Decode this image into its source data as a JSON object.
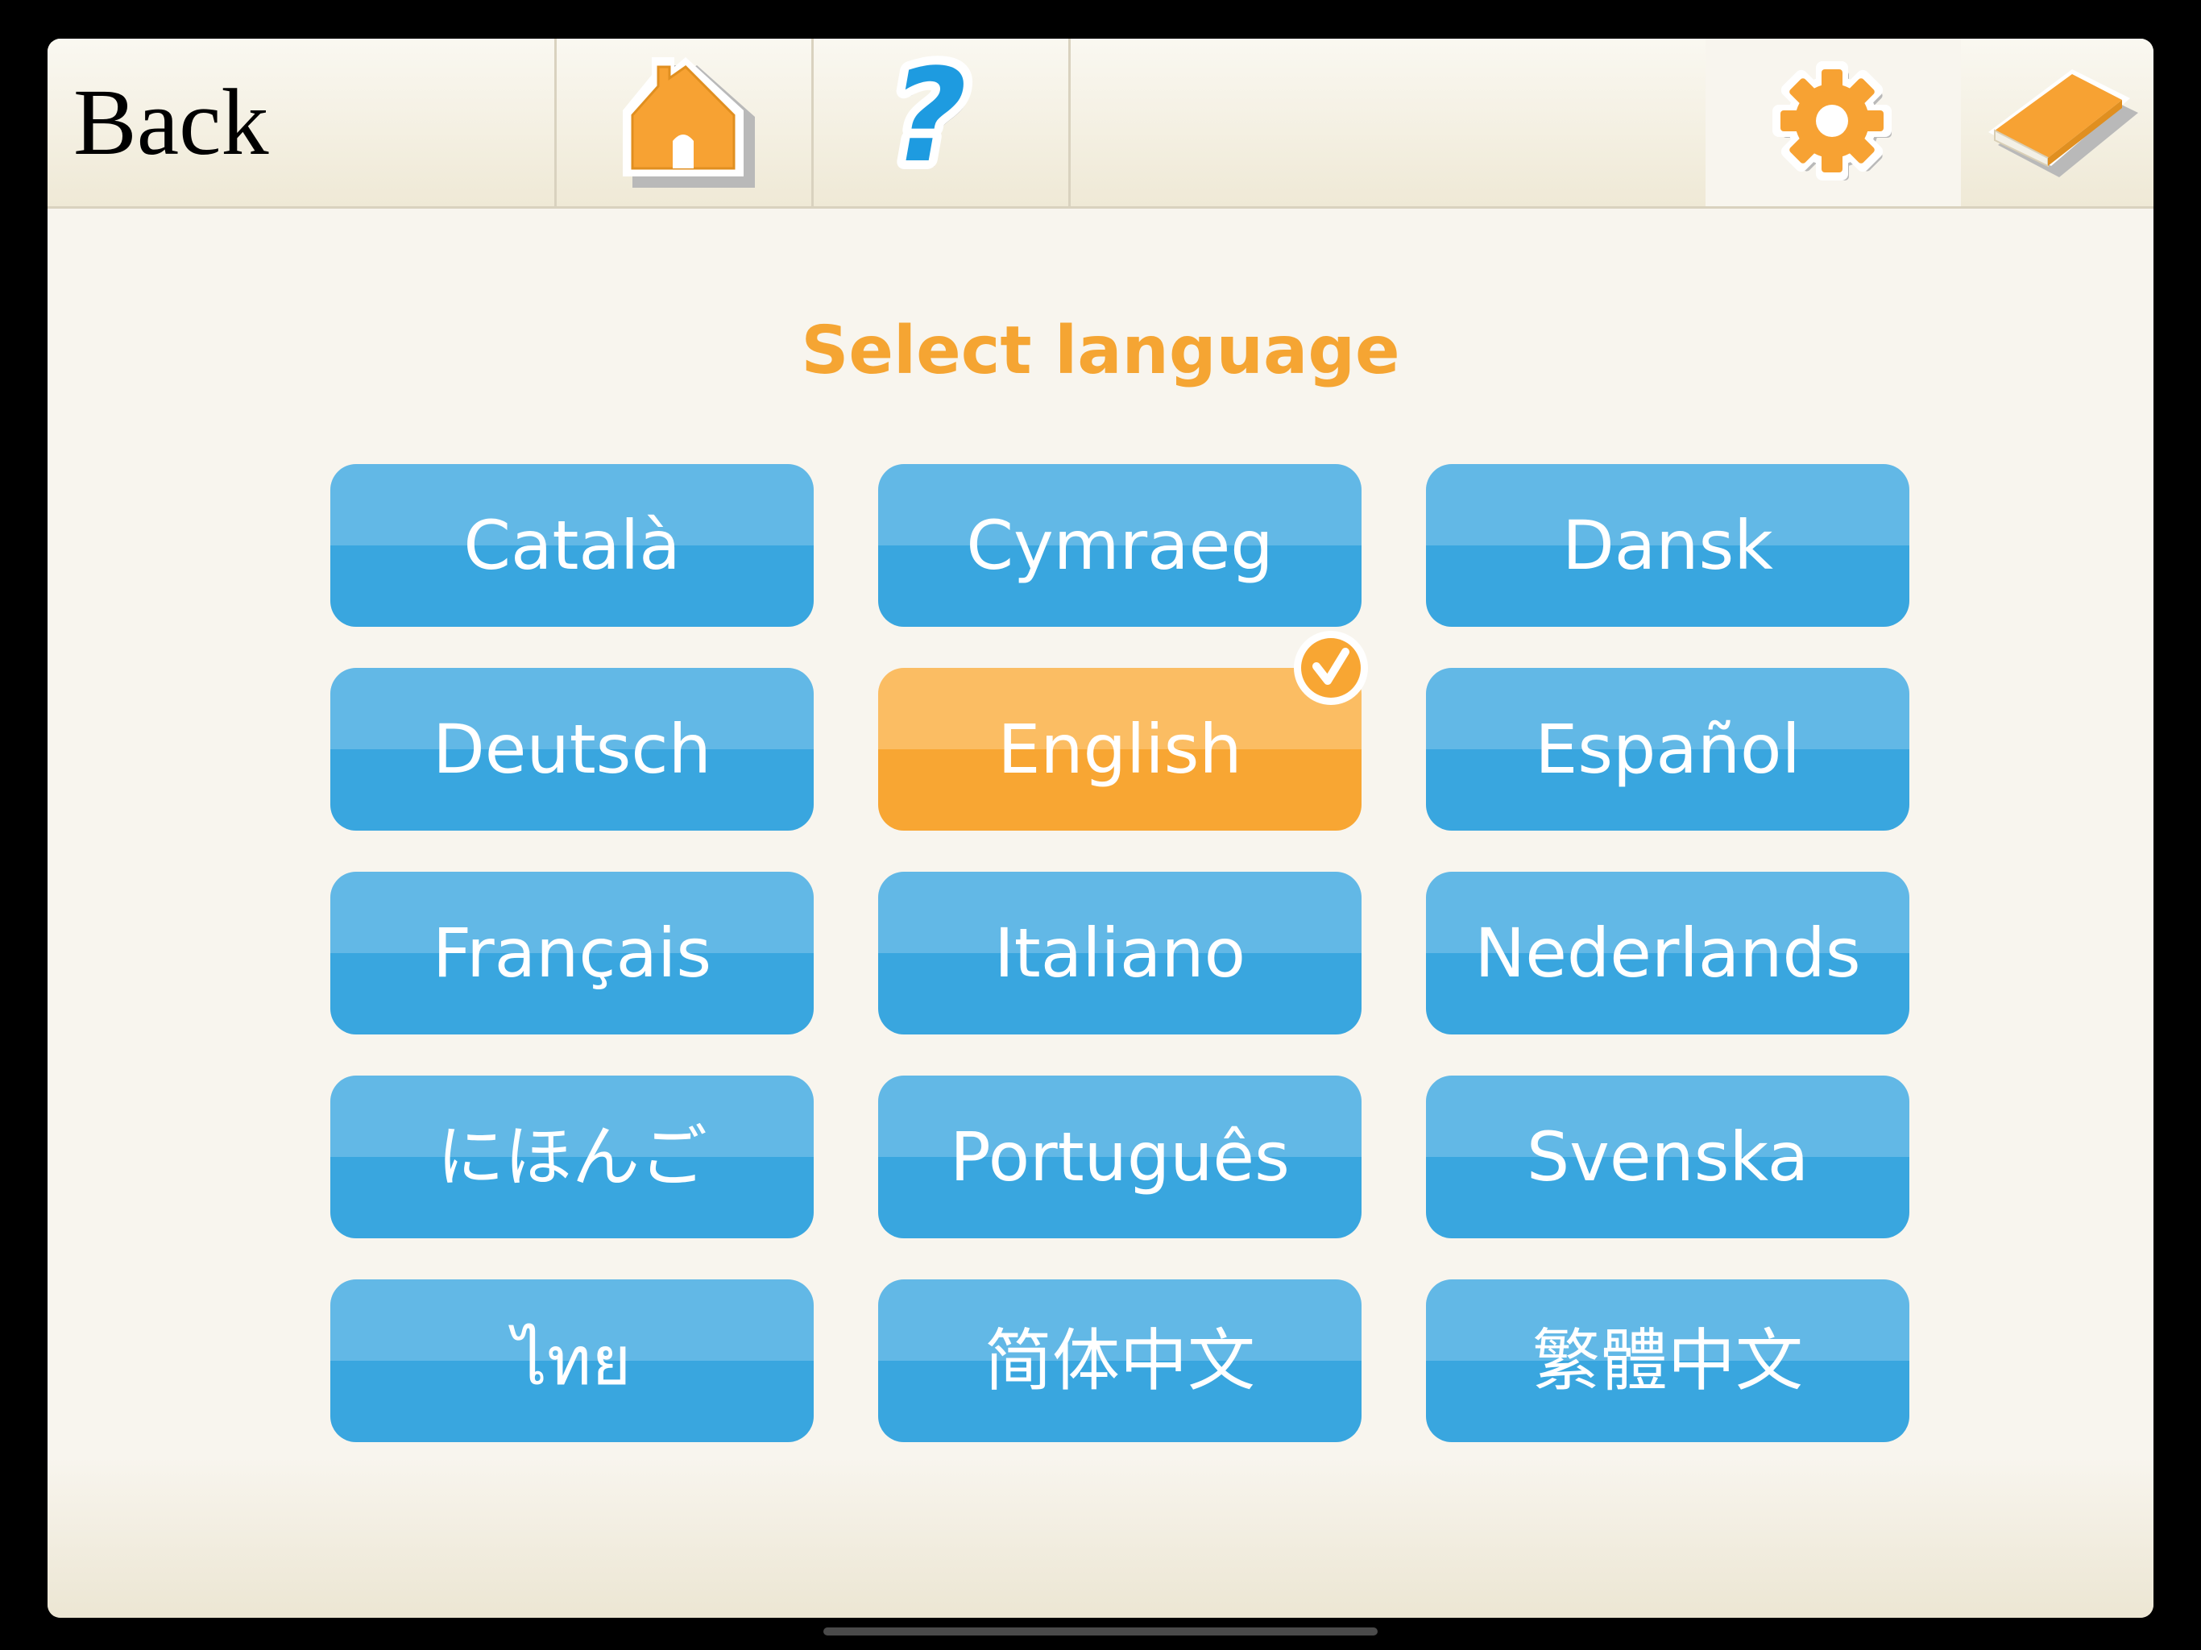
{
  "toolbar": {
    "back_label": "Back",
    "icons": {
      "home": "home-icon",
      "help": "help-icon",
      "settings": "gear-icon",
      "book": "book-icon"
    }
  },
  "main": {
    "title": "Select language",
    "selected": "English",
    "languages": [
      "Català",
      "Cymraeg",
      "Dansk",
      "Deutsch",
      "English",
      "Español",
      "Français",
      "Italiano",
      "Nederlands",
      "にほんご",
      "Português",
      "Svenska",
      "ไทย",
      "简体中文",
      "繁體中文"
    ]
  },
  "colors": {
    "accent_orange": "#f5a533",
    "button_blue": "#39a6df",
    "button_blue_light": "#62b8e6",
    "selected_orange": "#f8a633",
    "background": "#f8f5ee"
  }
}
